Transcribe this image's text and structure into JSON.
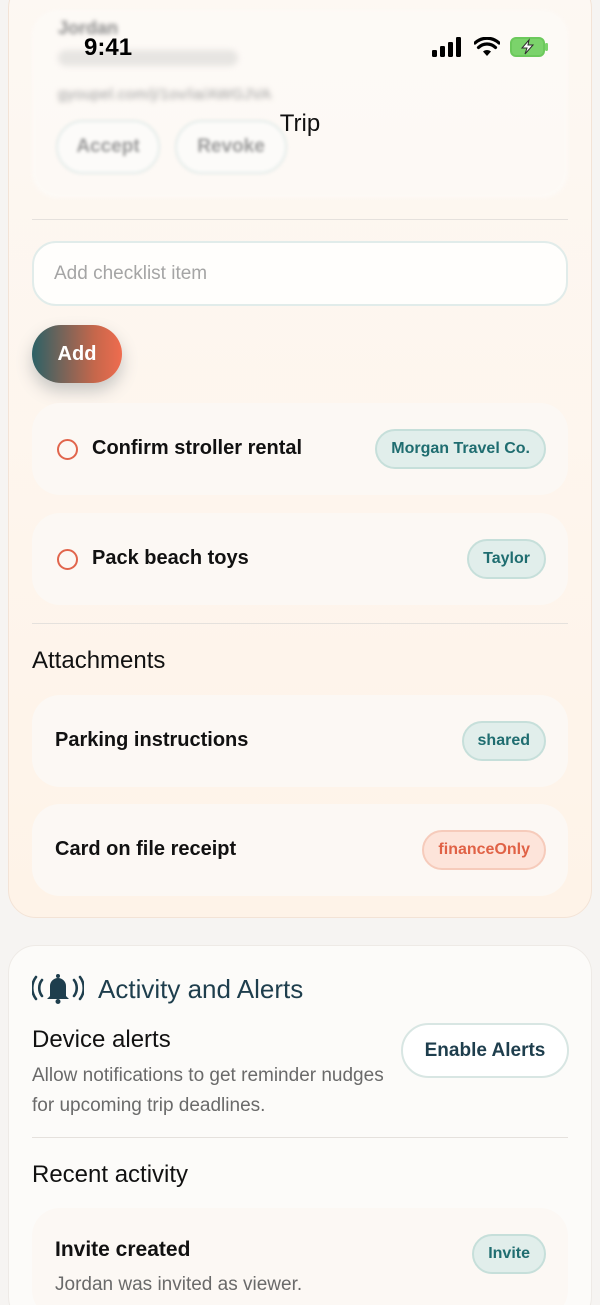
{
  "status": {
    "time": "9:41"
  },
  "nav": {
    "title": "Trip"
  },
  "invite_card": {
    "name": "Jordan",
    "url": "gyoupel.com/j/1ov/ia/AWGJVA",
    "accept_label": "Accept",
    "revoke_label": "Revoke"
  },
  "checklist": {
    "input_placeholder": "Add checklist item",
    "input_value": "",
    "add_label": "Add",
    "items": [
      {
        "label": "Confirm stroller rental",
        "assignee": "Morgan Travel Co."
      },
      {
        "label": "Pack beach toys",
        "assignee": "Taylor"
      }
    ]
  },
  "attachments": {
    "title": "Attachments",
    "items": [
      {
        "label": "Parking instructions",
        "visibility": "shared"
      },
      {
        "label": "Card on file receipt",
        "visibility": "financeOnly"
      }
    ]
  },
  "activity": {
    "title": "Activity and Alerts",
    "device_alerts_title": "Device alerts",
    "device_alerts_desc": "Allow notifications to get reminder nudges for upcoming trip deadlines.",
    "enable_label": "Enable Alerts",
    "recent_title": "Recent activity",
    "items": [
      {
        "title": "Invite created",
        "desc": "Jordan was invited as viewer.",
        "badge": "Invite"
      }
    ]
  },
  "colors": {
    "accent_teal": "#1f6d70",
    "accent_coral": "#e06246",
    "heading_navy": "#1e3e4d"
  }
}
